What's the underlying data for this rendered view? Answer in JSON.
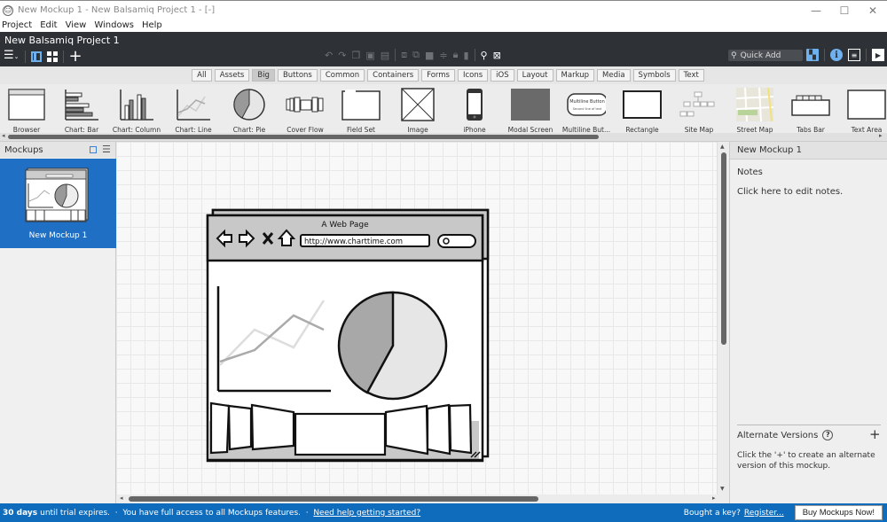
{
  "window": {
    "title": "New Mockup 1 - New Balsamiq Project 1 - [-]",
    "app_icon": "smiley-icon",
    "controls": {
      "minimize": "—",
      "maximize": "☐",
      "close": "✕"
    }
  },
  "menu": [
    "Project",
    "Edit",
    "View",
    "Windows",
    "Help"
  ],
  "project": {
    "name": "New Balsamiq Project 1"
  },
  "toolbar": {
    "left_icons": [
      "hamburger-menu-icon",
      "single-view-icon",
      "grid-view-icon",
      "add-icon"
    ],
    "center_icons": [
      "undo-icon",
      "redo-icon",
      "copy-icon",
      "paste-icon",
      "clipboard-icon",
      "group-icon",
      "ungroup-icon",
      "arrange-icon",
      "align-icon",
      "lock-icon",
      "trash-icon",
      "search-icon",
      "fullscreen-icon"
    ],
    "quick_add_placeholder": "Quick Add",
    "right_icons": [
      "ui-library-icon",
      "info-icon",
      "notes-icon",
      "present-icon"
    ]
  },
  "library_tabs": {
    "items": [
      "All",
      "Assets",
      "Big",
      "Buttons",
      "Common",
      "Containers",
      "Forms",
      "Icons",
      "iOS",
      "Layout",
      "Markup",
      "Media",
      "Symbols",
      "Text"
    ],
    "active": "Big"
  },
  "library_items": [
    {
      "label": "Browser",
      "icon": "browser"
    },
    {
      "label": "Chart: Bar",
      "icon": "bar"
    },
    {
      "label": "Chart: Column",
      "icon": "column"
    },
    {
      "label": "Chart: Line",
      "icon": "line"
    },
    {
      "label": "Chart: Pie",
      "icon": "pie"
    },
    {
      "label": "Cover Flow",
      "icon": "coverflow"
    },
    {
      "label": "Field Set",
      "icon": "fieldset"
    },
    {
      "label": "Image",
      "icon": "image"
    },
    {
      "label": "iPhone",
      "icon": "iphone"
    },
    {
      "label": "Modal Screen",
      "icon": "modal"
    },
    {
      "label": "Multiline But...",
      "icon": "multibtn"
    },
    {
      "label": "Rectangle",
      "icon": "rect"
    },
    {
      "label": "Site Map",
      "icon": "sitemap"
    },
    {
      "label": "Street Map",
      "icon": "streetmap"
    },
    {
      "label": "Tabs Bar",
      "icon": "tabs"
    },
    {
      "label": "Text Area",
      "icon": "textarea"
    }
  ],
  "multiline_button": {
    "line1": "Multiline Button",
    "line2": "Second line of text"
  },
  "sidebar": {
    "title": "Mockups",
    "items": [
      {
        "label": "New Mockup 1",
        "selected": true
      }
    ]
  },
  "mockup": {
    "browser_title": "A Web Page",
    "url": "http://www.charttime.com"
  },
  "right_panel": {
    "title": "New Mockup 1",
    "notes_label": "Notes",
    "notes_placeholder": "Click here to edit notes.",
    "alt_versions_label": "Alternate Versions",
    "alt_versions_help": "?",
    "alt_versions_add": "+",
    "alt_versions_text": "Click the '+' to create an alternate version of this mockup."
  },
  "status": {
    "trial_days": "30 days",
    "trial_text": "until trial expires.  ·  You have full access to all Mockups features.  ·  ",
    "help_link": "Need help getting started?",
    "key_text": "Bought a key?",
    "register_link": "Register...",
    "buy_button": "Buy Mockups Now!"
  },
  "colors": {
    "accent": "#1f6fc5",
    "status_bar": "#0f6cbd",
    "dark_toolbar": "#2e3236"
  }
}
